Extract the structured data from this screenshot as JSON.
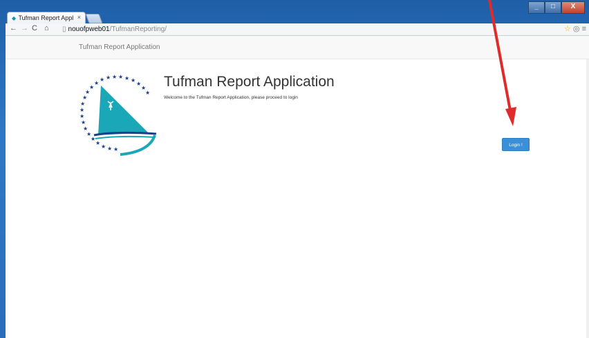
{
  "browser": {
    "tab_title": "Tufman Report Appl",
    "tab_close": "×",
    "url_host": "nouofpweb01",
    "url_path": "/TufmanReporting/",
    "window_controls": [
      "_",
      "□",
      "X"
    ],
    "icons": [
      "back-icon",
      "forward-icon",
      "reload-icon",
      "home-icon",
      "page-icon",
      "star-icon",
      "extension-icon",
      "menu-icon"
    ]
  },
  "navbar": {
    "brand": "Tufman Report Application"
  },
  "main": {
    "heading": "Tufman Report Application",
    "welcome_text": "Welcome to the Tufman Report Application, please proceed to login",
    "login_button": "Login !"
  },
  "colors": {
    "login_button": "#3a8fd6",
    "logo_teal": "#1aa7b8",
    "logo_star": "#1b3d8a",
    "annotation_arrow": "#e02b2b"
  }
}
